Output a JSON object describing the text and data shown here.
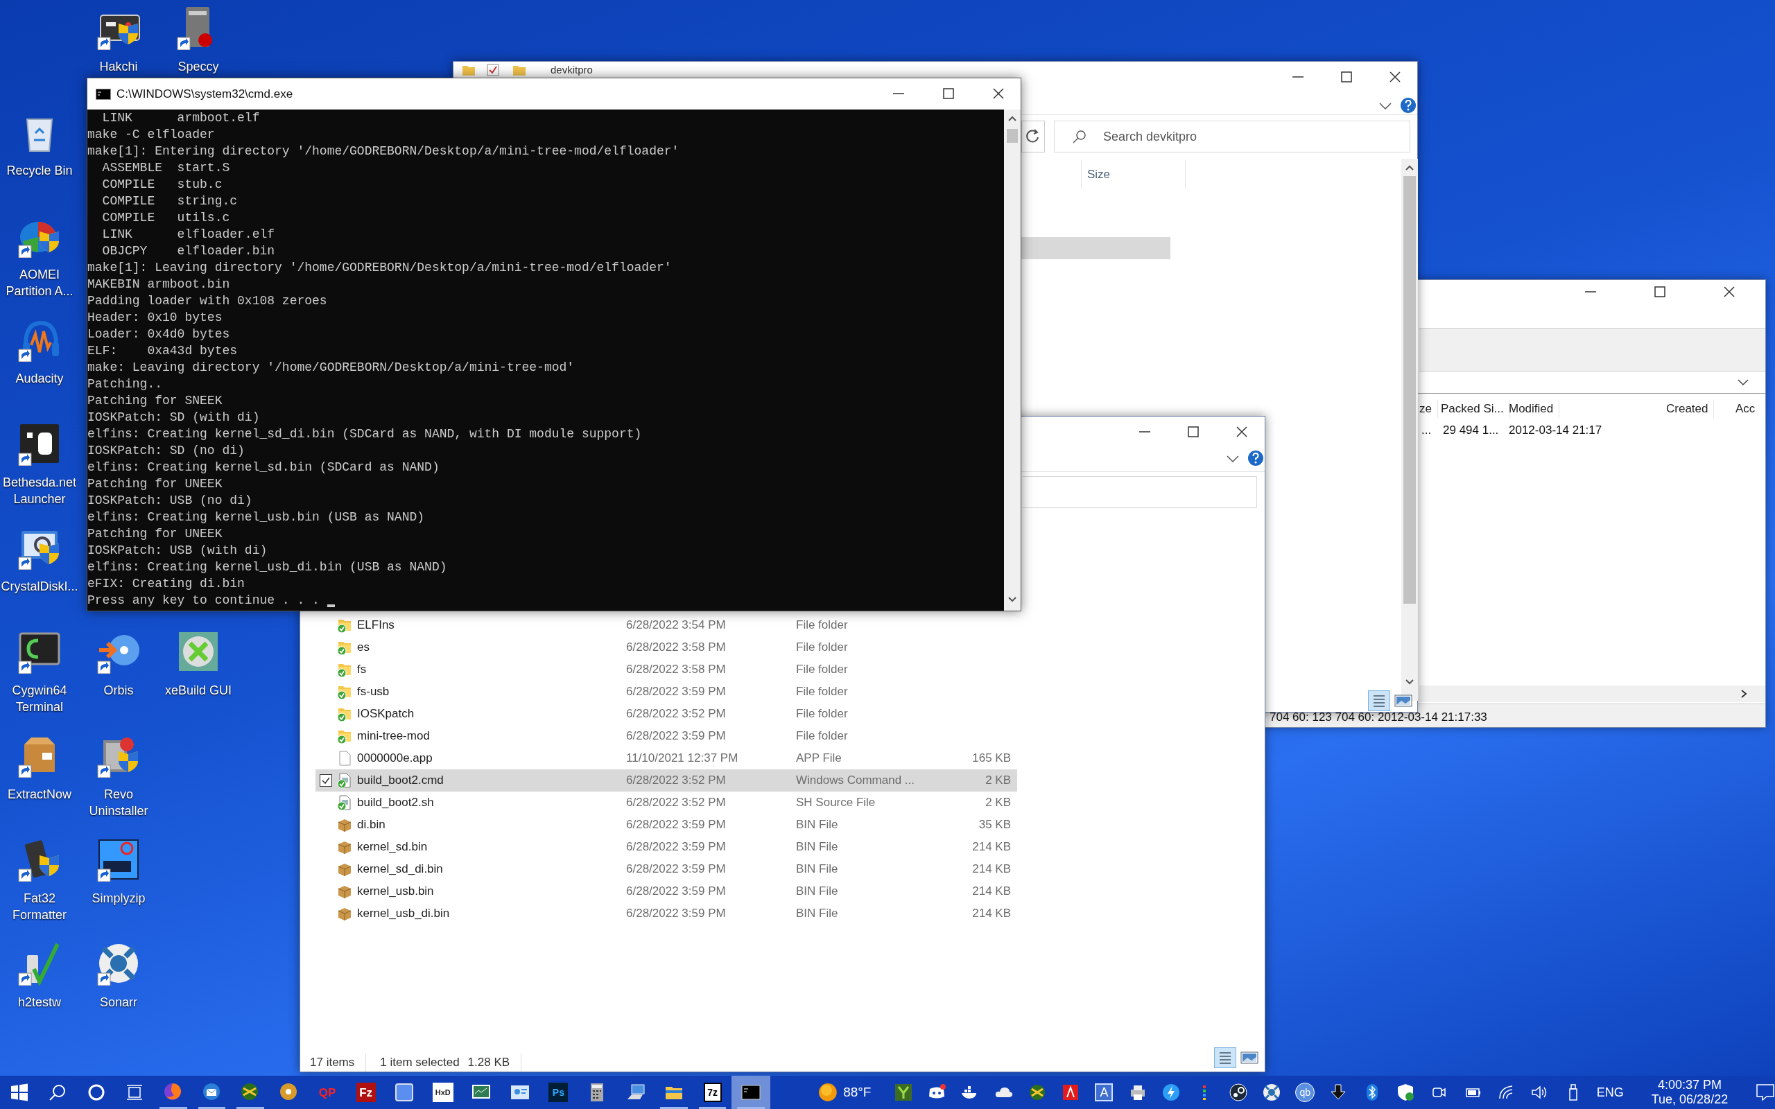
{
  "desktop_icons": [
    {
      "label": "Hakchi"
    },
    {
      "label": "Speccy"
    },
    {
      "label": "Recycle Bin"
    },
    {
      "label": "AOMEI Partition A..."
    },
    {
      "label": "Audacity"
    },
    {
      "label": "Bethesda.net Launcher"
    },
    {
      "label": "CrystalDiskI..."
    },
    {
      "label": "Cygwin64 Terminal"
    },
    {
      "label": "Orbis"
    },
    {
      "label": "xeBuild GUI"
    },
    {
      "label": "ExtractNow"
    },
    {
      "label": "Revo Uninstaller"
    },
    {
      "label": "Fat32 Formatter"
    },
    {
      "label": "Simplyzip"
    },
    {
      "label": "h2testw"
    },
    {
      "label": "Sonarr"
    }
  ],
  "archive_window": {
    "columns": [
      "ze",
      "Packed Si...",
      "Modified",
      "Created",
      "Acc"
    ],
    "rows": [
      [
        "...",
        "29 494 1...",
        "2012-03-14 21:17"
      ]
    ],
    "status": "704 60: 123 704 60: 2012-03-14 21:17:33"
  },
  "explorer_back": {
    "title": "devkitpro",
    "search": {
      "placeholder": "Search devkitpro"
    },
    "columns": [
      "Size"
    ]
  },
  "explorer_front": {
    "files": [
      {
        "name": "ELFIns",
        "modified": "6/28/2022 3:54 PM",
        "type": "File folder",
        "kind": "folder",
        "synced": true,
        "selected": false
      },
      {
        "name": "es",
        "modified": "6/28/2022 3:58 PM",
        "type": "File folder",
        "kind": "folder",
        "synced": true,
        "selected": false
      },
      {
        "name": "fs",
        "modified": "6/28/2022 3:58 PM",
        "type": "File folder",
        "kind": "folder",
        "synced": true,
        "selected": false
      },
      {
        "name": "fs-usb",
        "modified": "6/28/2022 3:59 PM",
        "type": "File folder",
        "kind": "folder",
        "synced": true,
        "selected": false
      },
      {
        "name": "IOSKpatch",
        "modified": "6/28/2022 3:52 PM",
        "type": "File folder",
        "kind": "folder",
        "synced": true,
        "selected": false
      },
      {
        "name": "mini-tree-mod",
        "modified": "6/28/2022 3:59 PM",
        "type": "File folder",
        "kind": "folder",
        "synced": true,
        "selected": false
      },
      {
        "name": "0000000e.app",
        "modified": "11/10/2021 12:37 PM",
        "type": "APP File",
        "size": "165 KB",
        "kind": "file",
        "synced": false,
        "selected": false
      },
      {
        "name": "build_boot2.cmd",
        "modified": "6/28/2022 3:52 PM",
        "type": "Windows Command ...",
        "size": "2 KB",
        "kind": "script",
        "synced": true,
        "selected": true
      },
      {
        "name": "build_boot2.sh",
        "modified": "6/28/2022 3:52 PM",
        "type": "SH Source File",
        "size": "2 KB",
        "kind": "script",
        "synced": true,
        "selected": false
      },
      {
        "name": "di.bin",
        "modified": "6/28/2022 3:59 PM",
        "type": "BIN File",
        "size": "35 KB",
        "kind": "bin",
        "synced": false,
        "selected": false
      },
      {
        "name": "kernel_sd.bin",
        "modified": "6/28/2022 3:59 PM",
        "type": "BIN File",
        "size": "214 KB",
        "kind": "bin",
        "synced": false,
        "selected": false
      },
      {
        "name": "kernel_sd_di.bin",
        "modified": "6/28/2022 3:59 PM",
        "type": "BIN File",
        "size": "214 KB",
        "kind": "bin",
        "synced": false,
        "selected": false
      },
      {
        "name": "kernel_usb.bin",
        "modified": "6/28/2022 3:59 PM",
        "type": "BIN File",
        "size": "214 KB",
        "kind": "bin",
        "synced": false,
        "selected": false
      },
      {
        "name": "kernel_usb_di.bin",
        "modified": "6/28/2022 3:59 PM",
        "type": "BIN File",
        "size": "214 KB",
        "kind": "bin",
        "synced": false,
        "selected": false
      }
    ],
    "status": {
      "count": "17 items",
      "selection": "1 item selected",
      "selection_size": "1.28 KB"
    }
  },
  "cmd": {
    "title": "C:\\WINDOWS\\system32\\cmd.exe",
    "lines": [
      "  LINK      armboot.elf",
      "make -C elfloader",
      "make[1]: Entering directory '/home/GODREBORN/Desktop/a/mini-tree-mod/elfloader'",
      "  ASSEMBLE  start.S",
      "  COMPILE   stub.c",
      "  COMPILE   string.c",
      "  COMPILE   utils.c",
      "  LINK      elfloader.elf",
      "  OBJCPY    elfloader.bin",
      "make[1]: Leaving directory '/home/GODREBORN/Desktop/a/mini-tree-mod/elfloader'",
      "MAKEBIN armboot.bin",
      "Padding loader with 0x108 zeroes",
      "Header: 0x10 bytes",
      "Loader: 0x4d0 bytes",
      "ELF:    0xa43d bytes",
      "make: Leaving directory '/home/GODREBORN/Desktop/a/mini-tree-mod'",
      "Patching..",
      "Patching for SNEEK",
      "IOSKPatch: SD (with di)",
      "elfins: Creating kernel_sd_di.bin (SDCard as NAND, with DI module support)",
      "IOSKPatch: SD (no di)",
      "elfins: Creating kernel_sd.bin (SDCard as NAND)",
      "Patching for UNEEK",
      "IOSKPatch: USB (no di)",
      "elfins: Creating kernel_usb.bin (USB as NAND)",
      "Patching for UNEEK",
      "IOSKPatch: USB (with di)",
      "elfins: Creating kernel_usb_di.bin (USB as NAND)",
      "eFIX: Creating di.bin",
      "Press any key to continue . . . "
    ]
  },
  "taskbar": {
    "apps": [
      {
        "running": true,
        "active": false
      },
      {
        "running": true,
        "active": false
      },
      {
        "running": true,
        "active": false
      },
      {
        "running": false,
        "active": false
      },
      {
        "label": "QP",
        "running": false,
        "active": false
      },
      {
        "label": "Fz",
        "running": false,
        "active": false
      },
      {
        "running": false,
        "active": false
      },
      {
        "label": "HxD",
        "running": false,
        "active": false
      },
      {
        "running": false,
        "active": false
      },
      {
        "running": false,
        "active": false
      },
      {
        "label": "Ps",
        "running": false,
        "active": false
      },
      {
        "running": false,
        "active": false
      },
      {
        "running": false,
        "active": false
      },
      {
        "running": true,
        "active": false
      },
      {
        "label": "7z",
        "running": true,
        "active": false
      },
      {
        "running": true,
        "active": true
      }
    ],
    "weather": "88°F",
    "tray_letter": "A",
    "tray_torrent": "qb",
    "language": "ENG",
    "time": "4:00:37 PM",
    "date": "Tue, 06/28/22"
  }
}
